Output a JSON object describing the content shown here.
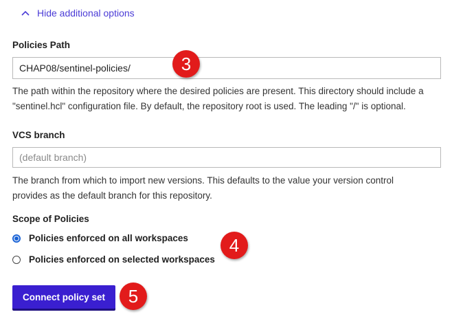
{
  "toggle": {
    "label": "Hide additional options"
  },
  "policies_path": {
    "label": "Policies Path",
    "value": "CHAP08/sentinel-policies/",
    "help_line1": "The path within the repository where the desired policies are present. This directory should include a",
    "help_line2": "\"sentinel.hcl\" configuration file. By default, the repository root is used. The leading \"/\" is optional."
  },
  "vcs_branch": {
    "label": "VCS branch",
    "placeholder": "(default branch)",
    "value": "",
    "help_line1": "The branch from which to import new versions. This defaults to the value your version control",
    "help_line2": "provides as the default branch for this repository."
  },
  "scope": {
    "label": "Scope of Policies",
    "options": [
      {
        "pre": "Policies enforced on ",
        "em": "all",
        "post": " workspaces",
        "checked": true
      },
      {
        "pre": "Policies enforced on ",
        "em": "selected",
        "post": " workspaces",
        "checked": false
      }
    ]
  },
  "submit": {
    "label": "Connect policy set"
  },
  "callouts": {
    "one": "3",
    "two": "4",
    "three": "5"
  },
  "colors": {
    "link": "#4a3bd6",
    "primary_button": "#3a1fd0",
    "radio_selected": "#1a63d6",
    "callout": "#e21b1b"
  },
  "icons": {
    "toggle": "chevron-up-icon"
  }
}
